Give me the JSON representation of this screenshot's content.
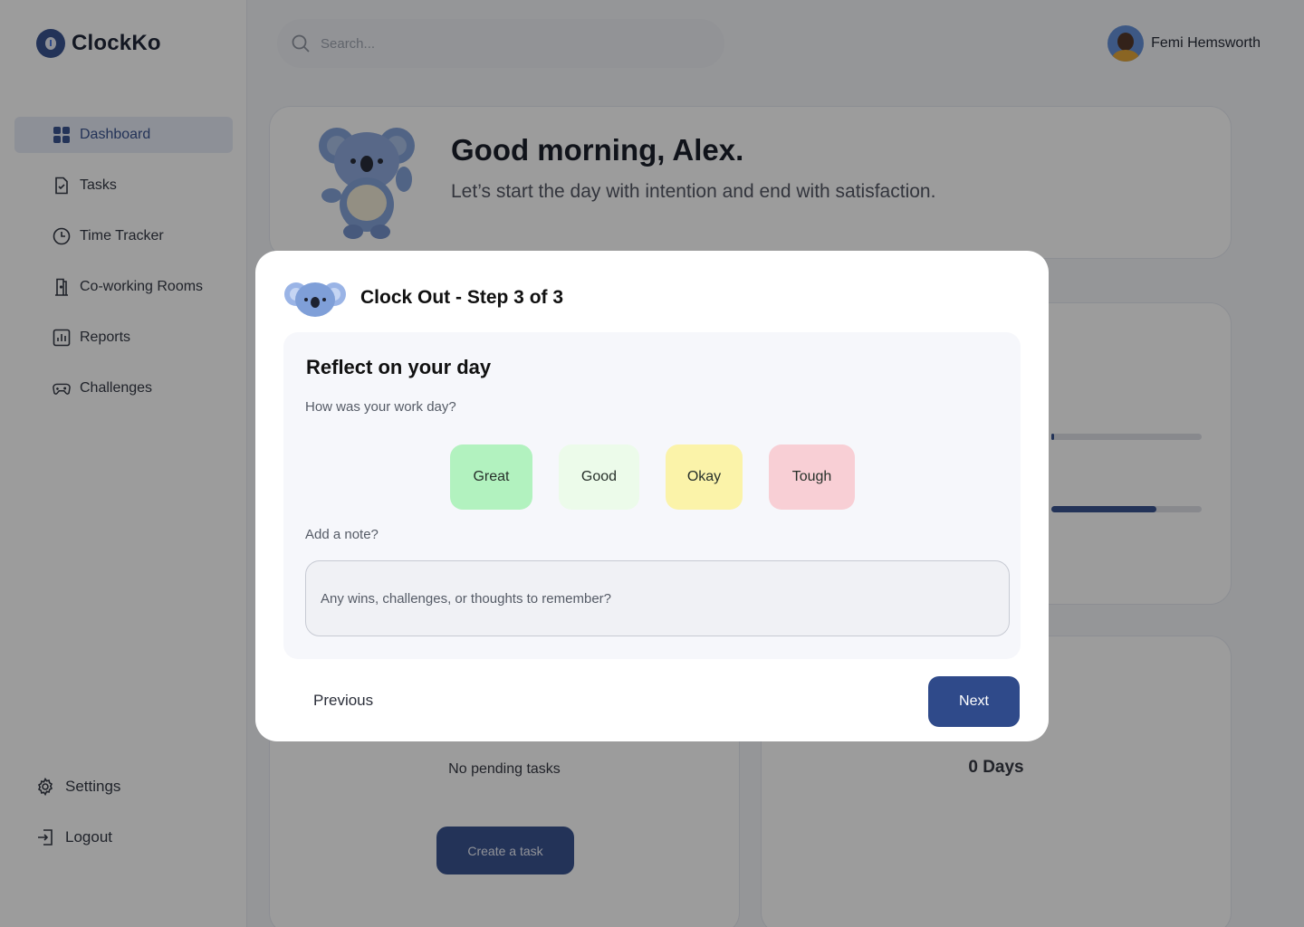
{
  "app": {
    "name": "ClockKo"
  },
  "sidebar": {
    "items": [
      {
        "label": "Dashboard",
        "icon": "dashboard-grid-icon",
        "active": true
      },
      {
        "label": "Tasks",
        "icon": "task-file-icon"
      },
      {
        "label": "Time Tracker",
        "icon": "clock-icon"
      },
      {
        "label": "Co-working Rooms",
        "icon": "door-icon"
      },
      {
        "label": "Reports",
        "icon": "bar-chart-icon"
      },
      {
        "label": "Challenges",
        "icon": "gamepad-icon"
      }
    ],
    "bottom": [
      {
        "label": "Settings",
        "icon": "gear-icon"
      },
      {
        "label": "Logout",
        "icon": "logout-icon"
      }
    ]
  },
  "header": {
    "search_placeholder": "Search...",
    "user_name": "Femi Hemsworth"
  },
  "greeting": {
    "title": "Good morning, Alex.",
    "subtitle": "Let’s start the day with intention and end with satisfaction."
  },
  "progress": {
    "bar1_fill": 0.02,
    "bar2_fill": 0.7
  },
  "tasks_card": {
    "empty_text": "No pending tasks",
    "create_button": "Create a task"
  },
  "streak_card": {
    "value": "0 Days"
  },
  "colors": {
    "brand": "#2f4a8a",
    "great": "#b2f2bf",
    "good": "#ecfbea",
    "okay": "#fbf3a9",
    "tough": "#f8cfd5"
  },
  "modal": {
    "title": "Clock Out - Step 3 of 3",
    "heading": "Reflect on your day",
    "question": "How was your work day?",
    "moods": [
      "Great",
      "Good",
      "Okay",
      "Tough"
    ],
    "note_label": "Add a note?",
    "note_placeholder": "Any wins, challenges, or thoughts to remember?",
    "previous_label": "Previous",
    "next_label": "Next"
  }
}
